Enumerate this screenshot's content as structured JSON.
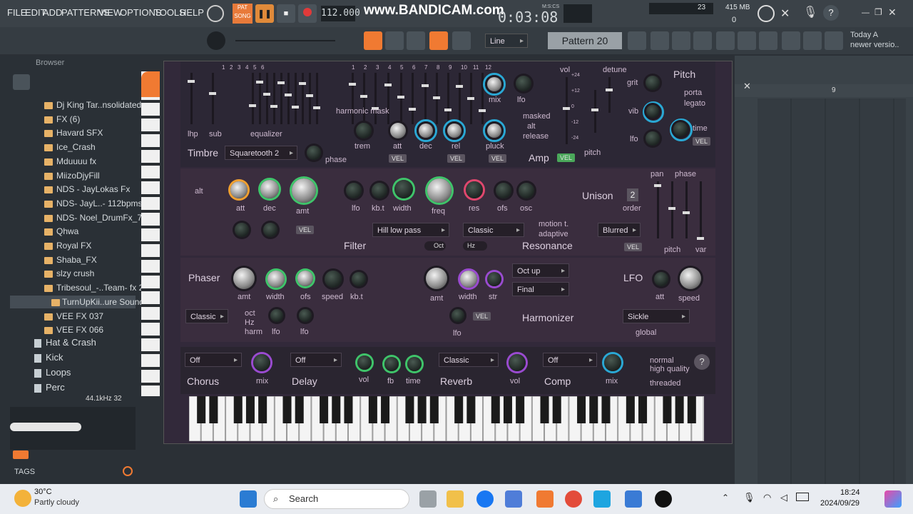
{
  "menu": [
    "FILE",
    "EDIT",
    "ADD",
    "PATTERNS",
    "VIEW",
    "OPTIONS",
    "TOOLS",
    "HELP"
  ],
  "transport": {
    "pat": "PAT",
    "song": "SONG",
    "tempo": "112.000",
    "time": "0:03:08",
    "mscs": "M:S:CS",
    "watermark": "www.BANDICAM.com"
  },
  "cpu": {
    "value": "23",
    "memory": "415 MB",
    "voices": "0"
  },
  "toolbar": {
    "snap": "Line",
    "pattern": "Pattern 20",
    "hint": "Today  A",
    "hint2": "newer versio.."
  },
  "browser": {
    "title": "Browser",
    "items": [
      "Dj King Tar..nsolidated)",
      "FX (6)",
      "Havard SFX",
      "Ice_Crash",
      "Mduuuu fx",
      "MiizoDjyFill",
      "NDS - JayLokas Fx",
      "NDS- JayL..- 112bpms",
      "NDS- Noel_DrumFx_7",
      "Qhwa",
      "Royal FX",
      "Shaba_FX",
      "slzy crush",
      "Tribesoul_-..Team- fx 2",
      "TurnUpKii..ure Sound",
      "VEE FX 037",
      "VEE FX 066"
    ],
    "folders": [
      "Hat & Crash",
      "Kick",
      "Loops",
      "Perc"
    ],
    "samplerate": "44.1kHz 32",
    "tags": "TAGS"
  },
  "plugin": {
    "timbre": {
      "title": "Timbre",
      "osc": "Squaretooth 2",
      "phase": "phase",
      "lhp": "lhp",
      "sub": "sub",
      "equalizer": "equalizer",
      "harmonic": "harmonic mask",
      "eq_nums": [
        "1",
        "2",
        "3",
        "4",
        "5",
        "6"
      ],
      "hm_nums": [
        "1",
        "2",
        "3",
        "4",
        "5",
        "6",
        "7",
        "8",
        "9",
        "10",
        "11",
        "12"
      ]
    },
    "amp": {
      "title": "Amp",
      "trem": "trem",
      "att": "att",
      "dec": "dec",
      "rel": "rel",
      "pluck": "pluck",
      "mix": "mix",
      "lfo": "lfo",
      "masked": "masked",
      "alt": "alt",
      "release": "release",
      "vol": "vol",
      "pitch": "pitch",
      "detune": "detune",
      "vel": "VEL",
      "scale": [
        "+24",
        "+12",
        "0",
        "-12",
        "-24"
      ]
    },
    "pitch": {
      "title": "Pitch",
      "grit": "grit",
      "vib": "vib",
      "lfo": "lfo",
      "porta": "porta",
      "legato": "legato",
      "time": "time",
      "vel": "VEL"
    },
    "filter": {
      "title": "Filter",
      "alt": "alt",
      "att": "att",
      "dec": "dec",
      "amt": "amt",
      "lfo": "lfo",
      "kbt": "kb.t",
      "width": "width",
      "freq": "freq",
      "res": "res",
      "ofs": "ofs",
      "osc": "osc",
      "type": "Hill low pass",
      "oct": "Oct",
      "vel": "VEL"
    },
    "resonance": {
      "title": "Resonance",
      "type": "Classic",
      "hz": "Hz",
      "motion": "motion t.",
      "adaptive": "adaptive"
    },
    "unison": {
      "title": "Unison",
      "order": "order",
      "count": "2",
      "pan": "pan",
      "phase": "phase",
      "pitch": "pitch",
      "var": "var",
      "type": "Blurred",
      "vel": "VEL"
    },
    "phaser": {
      "title": "Phaser",
      "amt": "amt",
      "width": "width",
      "ofs": "ofs",
      "speed": "speed",
      "kbt": "kb.t",
      "type": "Classic",
      "oct": "oct",
      "hz": "Hz",
      "harm": "harm",
      "lfo": "lfo",
      "lfo2": "lfo"
    },
    "harmonizer": {
      "title": "Harmonizer",
      "amt": "amt",
      "width": "width",
      "str": "str",
      "lfo": "lfo",
      "dd1": "Oct up",
      "dd2": "Final",
      "vel": "VEL"
    },
    "lfo": {
      "title": "LFO",
      "att": "att",
      "speed": "speed",
      "shape": "Sickle",
      "global": "global"
    },
    "fx": {
      "chorus": "Chorus",
      "chorus_val": "Off",
      "delay": "Delay",
      "delay_val": "Off",
      "reverb": "Reverb",
      "reverb_val": "Classic",
      "comp": "Comp",
      "comp_val": "Off",
      "mix": "mix",
      "vol": "vol",
      "fb": "fb",
      "time": "time",
      "mix2": "mix",
      "normal": "normal",
      "high": "high quality",
      "threaded": "threaded"
    }
  },
  "playlist": {
    "bar": "9"
  },
  "taskbar": {
    "temp": "30°C",
    "weather": "Partly cloudy",
    "search": "Search",
    "time": "18:24",
    "date": "2024/09/29"
  },
  "colors": {
    "accent": "#f07a32",
    "knob_ring": "#2aa8d4",
    "ring_green": "#3fc46a",
    "ring_pink": "#e0476e",
    "ring_purple": "#9a4bd0"
  }
}
